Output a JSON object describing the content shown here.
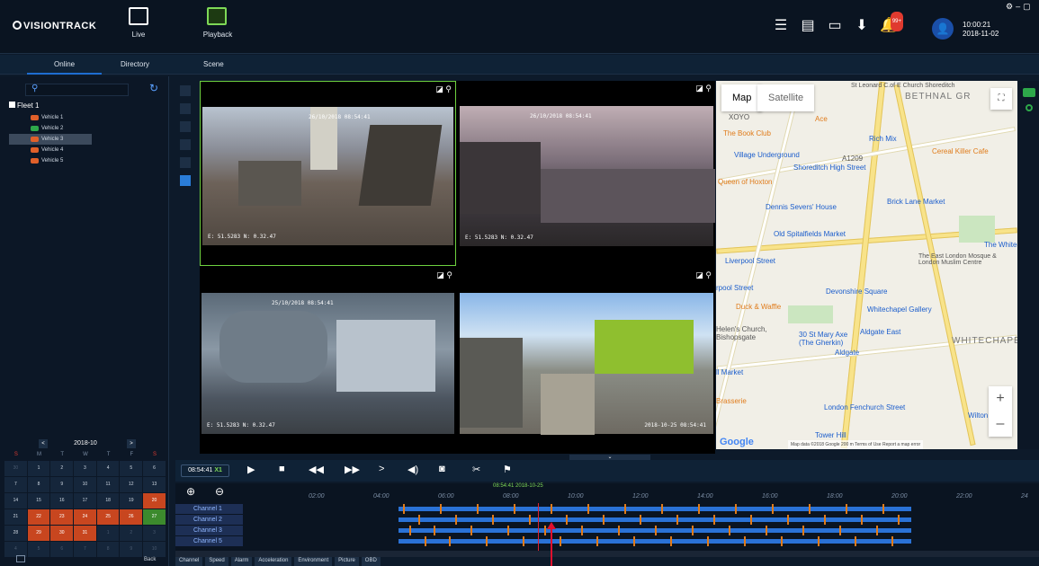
{
  "app": {
    "logo_text": "VISIONTRACK"
  },
  "nav": {
    "live": "Live",
    "playback": "Playback"
  },
  "header": {
    "notification_count": "99+",
    "clock_time": "10:00:21",
    "clock_date": "2018-11-02"
  },
  "subtabs": {
    "online": "Online",
    "directory": "Directory",
    "scene": "Scene"
  },
  "tree": {
    "fleet": "Fleet 1",
    "vehicles": [
      {
        "label": "Vehicle 1",
        "color": "#e0602a"
      },
      {
        "label": "Vehicle 2",
        "color": "#2ea84a"
      },
      {
        "label": "Vehicle 3",
        "color": "#e0602a"
      },
      {
        "label": "Vehicle 4",
        "color": "#e0602a"
      },
      {
        "label": "Vehicle 5",
        "color": "#e0602a"
      }
    ]
  },
  "calendar": {
    "month": "2018-10",
    "prev": "<",
    "next": ">",
    "days": [
      "S",
      "M",
      "T",
      "W",
      "T",
      "F",
      "S"
    ],
    "weeks": [
      [
        "30",
        "1",
        "2",
        "3",
        "4",
        "5",
        "6"
      ],
      [
        "7",
        "8",
        "9",
        "10",
        "11",
        "12",
        "13"
      ],
      [
        "14",
        "15",
        "16",
        "17",
        "18",
        "19",
        "20"
      ],
      [
        "21",
        "22",
        "23",
        "24",
        "25",
        "26",
        "27"
      ],
      [
        "28",
        "29",
        "30",
        "31",
        "1",
        "2",
        "3"
      ],
      [
        "4",
        "5",
        "6",
        "7",
        "8",
        "9",
        "10"
      ]
    ]
  },
  "sidebar_bottom": {
    "back": "Back"
  },
  "videos": [
    {
      "timestamp": "26/10/2018 08:54:41",
      "gps": "E: 51.5283 N: 0.32.47"
    },
    {
      "timestamp": "26/10/2018 08:54:41",
      "gps": "E: 51.5283 N: 0.32.47"
    },
    {
      "timestamp": "25/10/2018 08:54:41",
      "gps": "E: 51.5283 N: 0.32.47"
    },
    {
      "timestamp": "",
      "gps": "2018-10-25 08:54:41"
    }
  ],
  "map": {
    "tab_map": "Map",
    "tab_satellite": "Satellite",
    "labels": {
      "st_leonard": "St Leonard C.of E Church Shoreditch",
      "bethnal": "BETHNAL GR",
      "xoyo": "XOYO",
      "ace": "Ace",
      "book_club": "The Book Club",
      "rich_mix": "Rich Mix",
      "cereal": "Cereal Killer Cafe",
      "village": "Village Underground",
      "shoreditch": "Shoreditch High Street",
      "a1209": "A1209",
      "queen": "Queen of Hoxton",
      "brick_lane": "Brick Lane Market",
      "severs": "Dennis Severs' House",
      "spitalfields": "Old Spitalfields Market",
      "whitechapel": "The Whitech",
      "liverpool": "Liverpool Street",
      "mosque": "The East London Mosque & London Muslim Centre",
      "lpool2": "rpool Street",
      "devonshire": "Devonshire Square",
      "duck": "Duck & Waffle",
      "gallery": "Whitechapel Gallery",
      "helens": "Helen's Church, Bishopsgate",
      "gherkin": "30 St Mary Axe (The Gherkin)",
      "aldgate_east": "Aldgate East",
      "whitechap_big": "WHITECHAPE",
      "aldgate": "Aldgate",
      "market": "ll Market",
      "fenchurch": "London Fenchurch Street",
      "brasserie": "Brasserie",
      "tower_hill": "Tower Hill",
      "wilton": "Wilton",
      "google": "Google",
      "footer": "Map data ©2018 Google   200 m       Terms of Use   Report a map error"
    }
  },
  "playback": {
    "time": "08:54:41",
    "speed": "X1"
  },
  "timeline": {
    "current": "08:54:41 2018-10-25",
    "ticks": [
      "02:00",
      "04:00",
      "06:00",
      "08:00",
      "10:00",
      "12:00",
      "14:00",
      "16:00",
      "18:00",
      "20:00",
      "22:00",
      "24"
    ],
    "channels": [
      "Channel 1",
      "Channel 2",
      "Channel 3",
      "Channel 5"
    ]
  },
  "data_tabs": [
    "Channel",
    "Speed",
    "Alarm",
    "Acceleration",
    "Environment",
    "Picture",
    "OBD"
  ]
}
